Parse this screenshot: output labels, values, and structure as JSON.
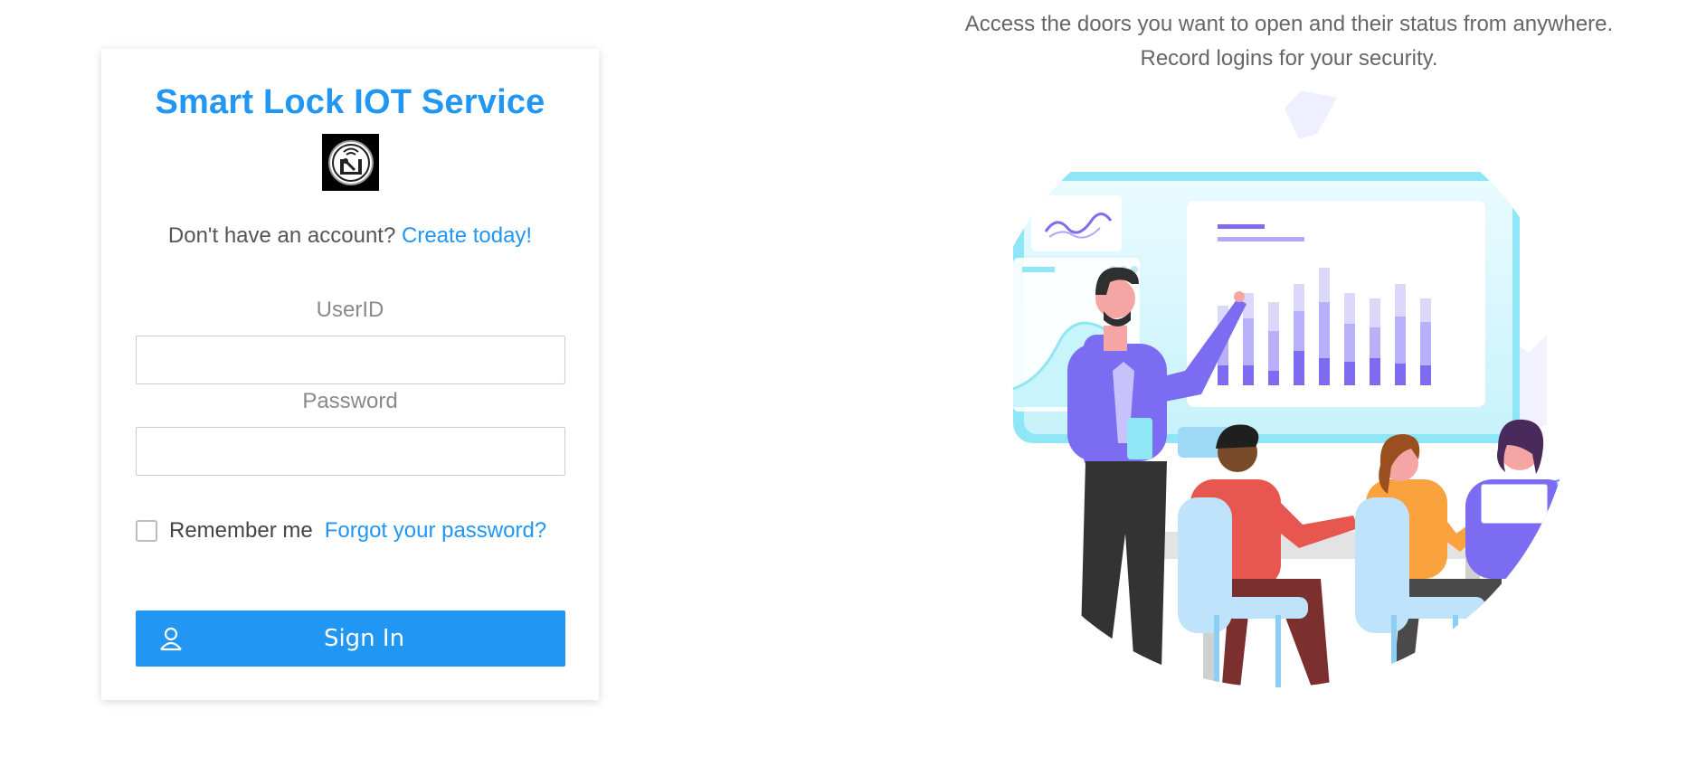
{
  "login": {
    "title": "Smart Lock IOT Service",
    "signup_prompt": "Don't have an account?",
    "signup_link": "Create today",
    "signup_suffix": "!",
    "userid_label": "UserID",
    "userid_value": "",
    "password_label": "Password",
    "password_value": "",
    "remember_label": "Remember me",
    "remember_checked": false,
    "forgot_link": "Forgot your password?",
    "signin_label": "Sign In",
    "signin_icon": "user-icon"
  },
  "hero": {
    "tagline_line1": "Access the doors you want to open and their status from anywhere.",
    "tagline_line2": "Record logins for your security."
  },
  "colors": {
    "accent": "#2196f3",
    "background": "#ffffff"
  }
}
